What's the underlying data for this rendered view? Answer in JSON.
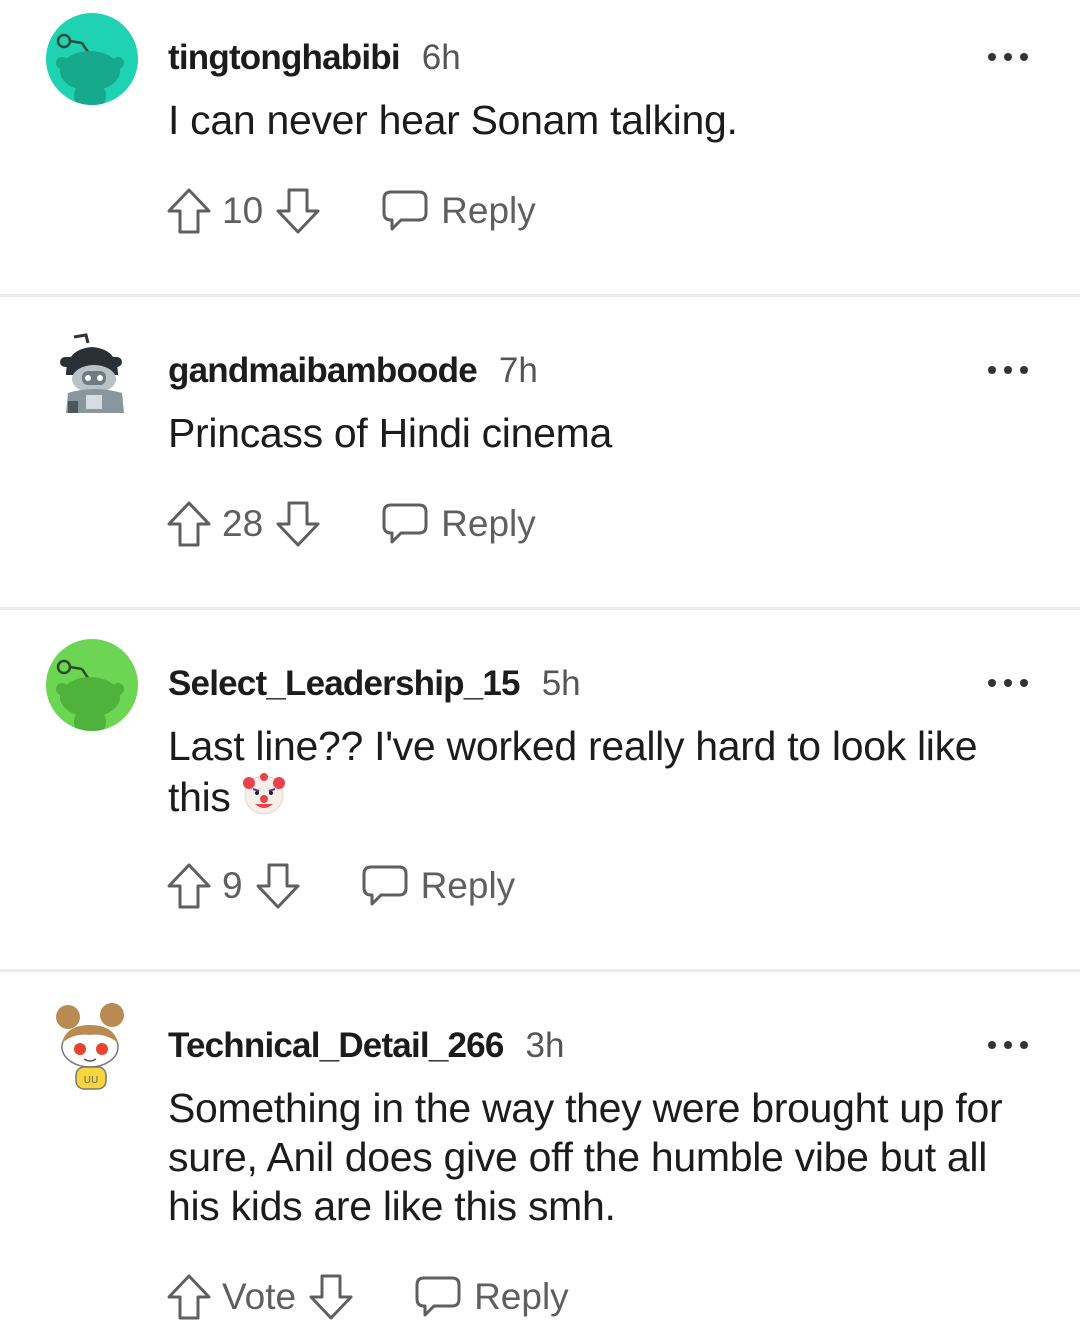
{
  "comments": [
    {
      "username": "tingtonghabibi",
      "time": "6h",
      "text": "I can never hear Sonam talking.",
      "votes": "10",
      "reply_label": "Reply"
    },
    {
      "username": "gandmaibamboode",
      "time": "7h",
      "text": "Princass of Hindi cinema",
      "votes": "28",
      "reply_label": "Reply"
    },
    {
      "username": "Select_Leadership_15",
      "time": "5h",
      "text": "Last line?? I've worked really hard to look like this",
      "emoji": "clown-face-icon",
      "votes": "9",
      "reply_label": "Reply"
    },
    {
      "username": "Technical_Detail_266",
      "time": "3h",
      "text": "Something in the way they were brought up for sure, Anil does give off the humble vibe but all his kids are like this smh.",
      "votes": "Vote",
      "reply_label": "Reply"
    }
  ],
  "colors": {
    "avatar_teal": "#1fd3b2",
    "avatar_green": "#6cd654",
    "divider": "#ebebeb",
    "meta_text": "#5f5f5f"
  }
}
